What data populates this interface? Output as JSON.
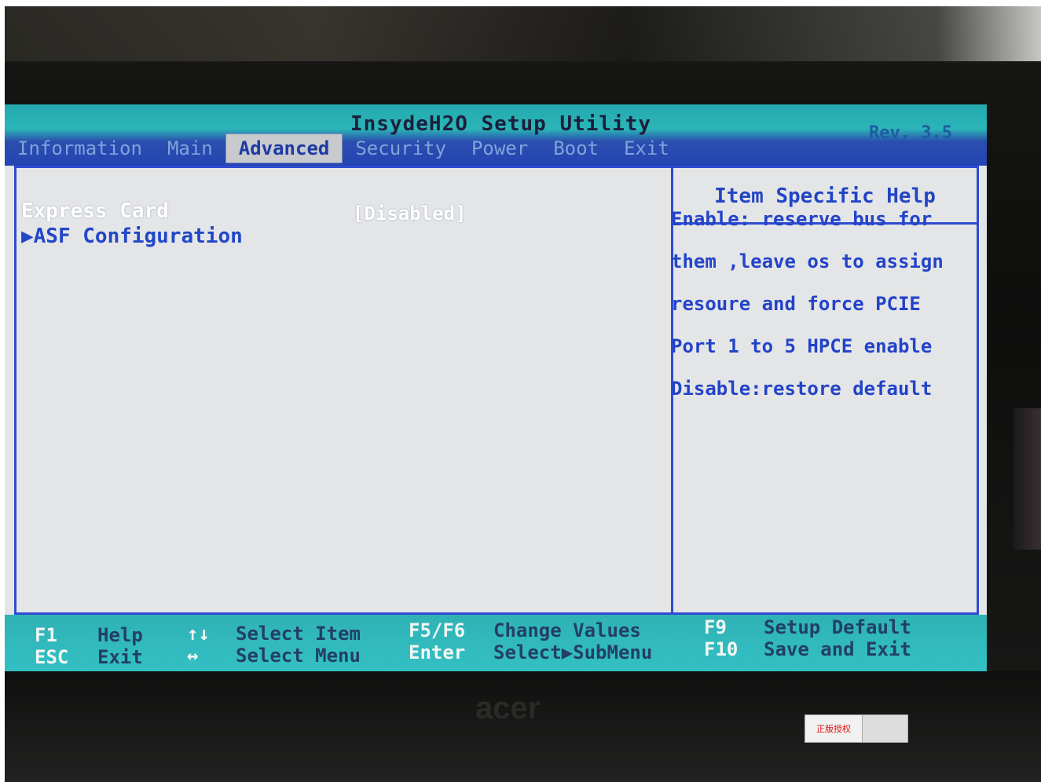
{
  "utility": {
    "title": "InsydeH2O Setup Utility",
    "revision": "Rev. 3.5"
  },
  "menu": {
    "items": [
      "Information",
      "Main",
      "Advanced",
      "Security",
      "Power",
      "Boot",
      "Exit"
    ],
    "active": "Advanced"
  },
  "settings": [
    {
      "label": "Express Card",
      "value": "[Disabled]"
    },
    {
      "label": "▶ASF Configuration",
      "value": ""
    }
  ],
  "help": {
    "title": "Item Specific Help",
    "lines": [
      "Enable: reserve bus for",
      "them ,leave os to assign",
      "resoure and force PCIE",
      "Port 1 to 5 HPCE enable",
      "Disable:restore default"
    ]
  },
  "footer": {
    "keys": [
      {
        "key": "F1",
        "desc": "Help"
      },
      {
        "key": "ESC",
        "desc": "Exit"
      },
      {
        "key": "↑↓",
        "desc": "Select Item"
      },
      {
        "key": "↔",
        "desc": "Select Menu"
      },
      {
        "key": "F5/F6",
        "desc": "Change Values"
      },
      {
        "key": "Enter",
        "desc": "Select▶SubMenu"
      },
      {
        "key": "F9",
        "desc": "Setup Default"
      },
      {
        "key": "F10",
        "desc": "Save and Exit"
      }
    ]
  },
  "photo": {
    "brand_logo": "acer",
    "sticker_text": "正版授权"
  },
  "colors": {
    "menu_highlight": "#c8cacd",
    "help_text": "#2343c8",
    "footer_bg": "#33c0c4",
    "panel_border": "#2e4bd0"
  }
}
